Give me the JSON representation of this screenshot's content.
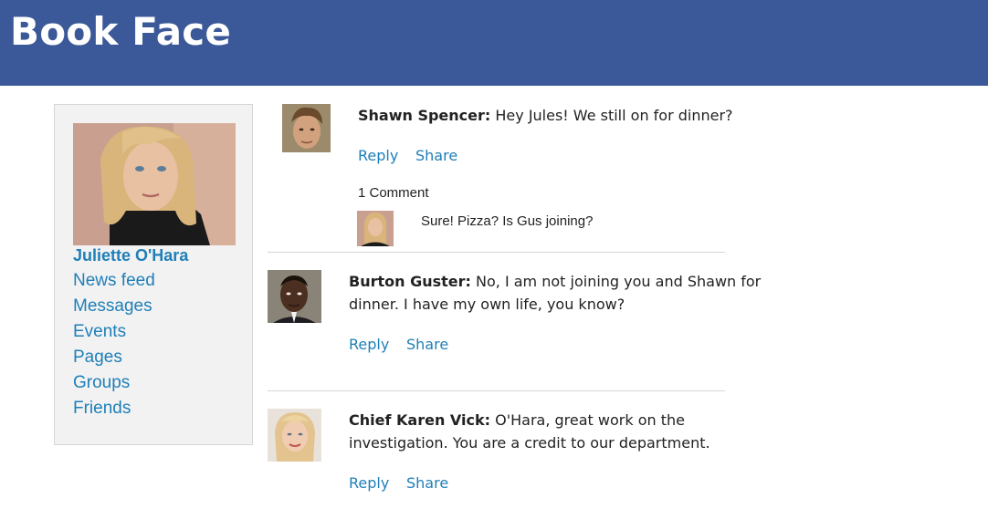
{
  "app": {
    "title": "Book Face"
  },
  "colors": {
    "header": "#3b5998",
    "link": "#1f7fb8",
    "sidebar_bg": "#f2f2f2"
  },
  "profile": {
    "name": "Juliette O'Hara",
    "nav": [
      "News feed",
      "Messages",
      "Events",
      "Pages",
      "Groups",
      "Friends"
    ]
  },
  "posts": [
    {
      "author": "Shawn Spencer:",
      "text": "Hey Jules! We still on for dinner?",
      "reply": "Reply",
      "share": "Share",
      "comment_count": "1 Comment",
      "comment_text": "Sure! Pizza? Is Gus joining?"
    },
    {
      "author": "Burton Guster:",
      "text_line1": "No, I am not joining you and Shawn for",
      "text_line2": "dinner. I have my own life, you know?",
      "reply": "Reply",
      "share": "Share"
    },
    {
      "author": "Chief Karen Vick:",
      "text_line1": "O'Hara, great work on the",
      "text_line2": "investigation. You are a credit to our department.",
      "reply": "Reply",
      "share": "Share"
    }
  ]
}
